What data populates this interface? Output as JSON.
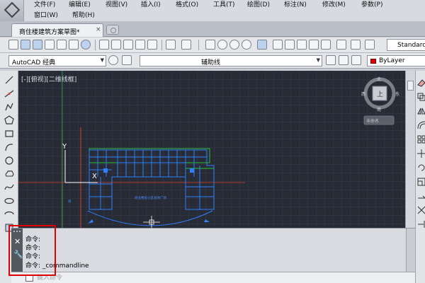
{
  "menu": {
    "row1": [
      "文件(F)",
      "编辑(E)",
      "视图(V)",
      "插入(I)",
      "格式(O)",
      "工具(T)",
      "绘图(D)",
      "标注(N)",
      "修改(M)",
      "参数(P)"
    ],
    "row2": [
      "窗口(W)",
      "帮助(H)"
    ]
  },
  "tabs": {
    "active": "商住楼建筑方案草图*",
    "close": "×"
  },
  "toolbar": {
    "text_style": "Standard"
  },
  "toolbar2": {
    "workspace": "AutoCAD 经典",
    "layer": "辅助线",
    "color": "ByLayer",
    "color_value": "#e00000"
  },
  "canvas": {
    "viewport_label": "[-][俯视][二维线框]",
    "background": "#272b35",
    "viewcube": {
      "top": "上",
      "north": "北",
      "south": "南",
      "west": "西",
      "east": "东",
      "wcs": "未命名"
    },
    "drawing_label": "商业楼层小区总体广场",
    "side_label": "商",
    "axis_y": "Y",
    "axis_x": "X"
  },
  "command": {
    "history": [
      "命令:",
      "命令:",
      "命令:",
      "命令:  _commandline"
    ],
    "placeholder": "键入命令"
  },
  "colors": {
    "building_blue": "#2f7fff",
    "building_green": "#24c13a",
    "guide_red": "#d83c28",
    "highlight": "#e00000"
  }
}
